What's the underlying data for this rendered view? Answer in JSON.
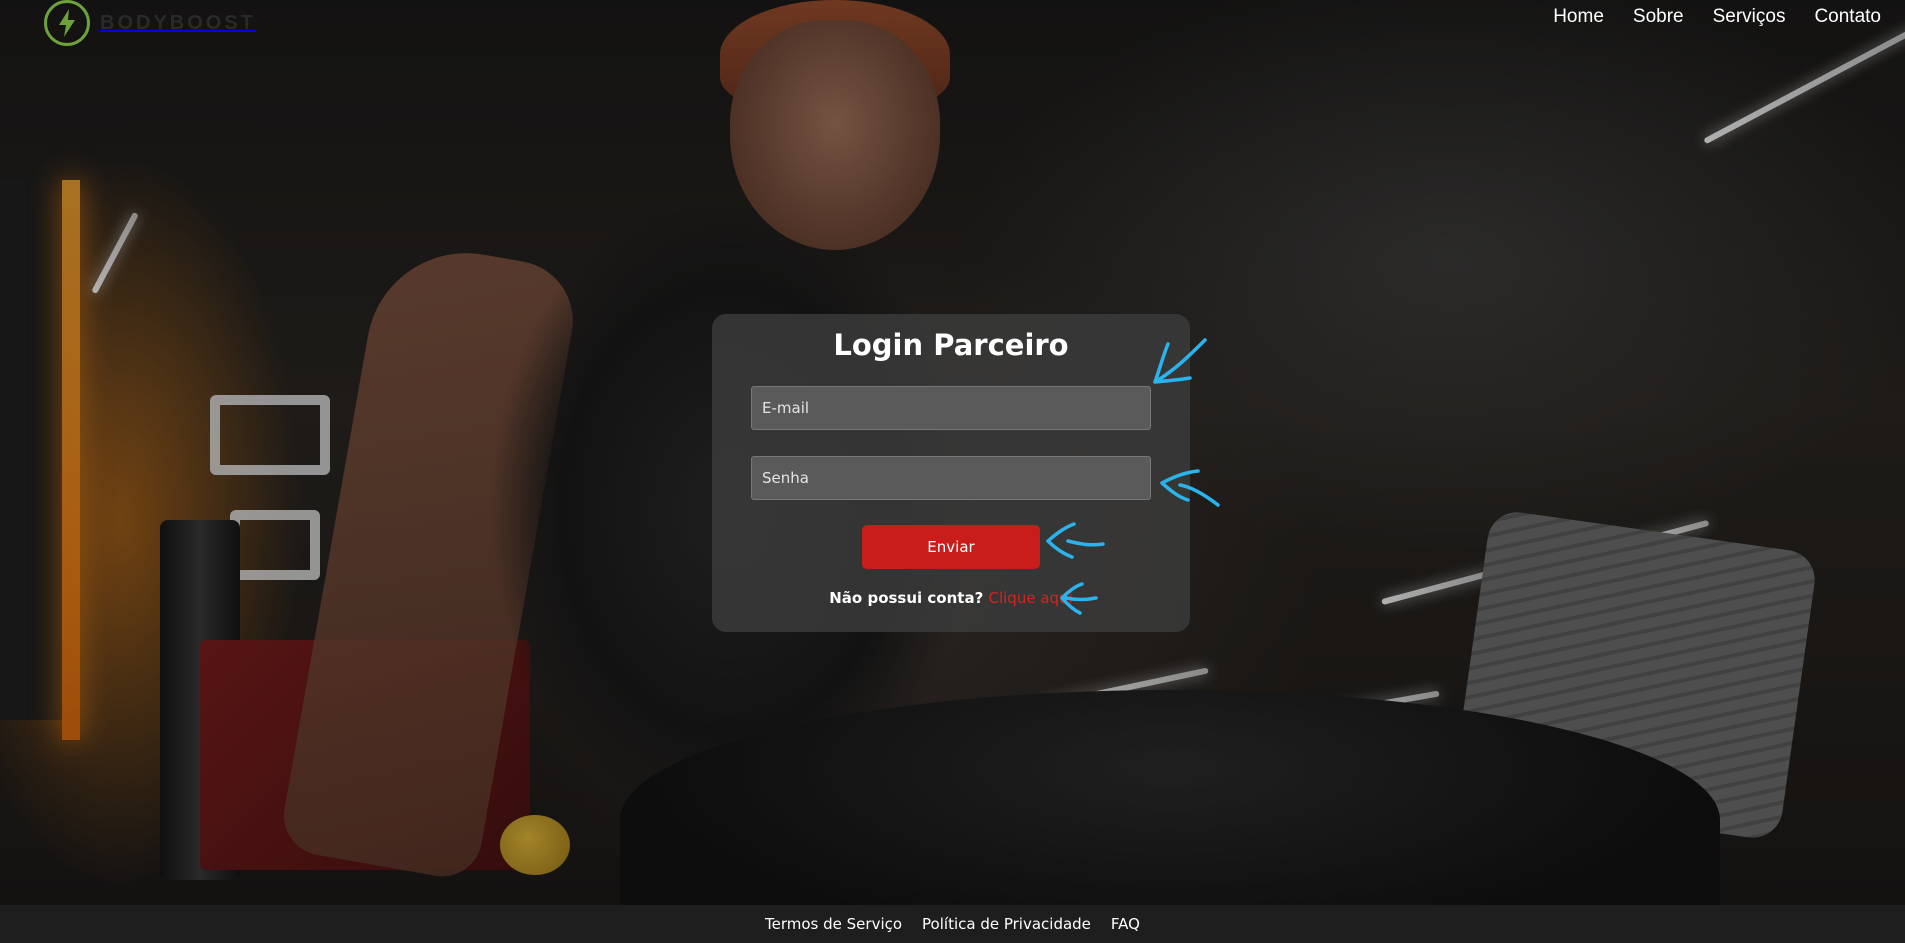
{
  "brand": {
    "name": "BODYBOOST",
    "icon": "lightning-bolt-icon",
    "accent": "#6da23a"
  },
  "nav": {
    "items": [
      {
        "label": "Home"
      },
      {
        "label": "Sobre"
      },
      {
        "label": "Serviços"
      },
      {
        "label": "Contato"
      }
    ]
  },
  "login": {
    "title": "Login Parceiro",
    "email_placeholder": "E-mail",
    "password_placeholder": "Senha",
    "submit_label": "Enviar",
    "signup_question": "Não possui conta?",
    "signup_link": "Clique aqui",
    "submit_color": "#c81d1a"
  },
  "footer": {
    "links": [
      {
        "label": "Termos de Serviço"
      },
      {
        "label": "Política de Privacidade"
      },
      {
        "label": "FAQ"
      }
    ]
  },
  "annotations": {
    "arrow_color": "#2ab4ee",
    "icon": "hand-drawn-arrow-icon"
  }
}
